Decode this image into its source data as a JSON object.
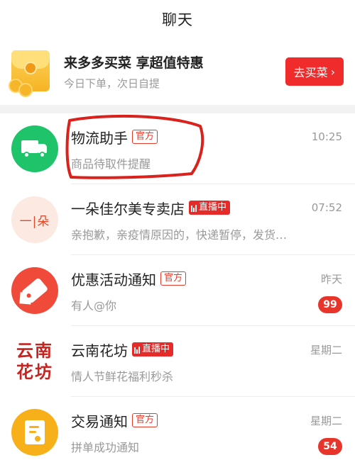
{
  "header": {
    "title": "聊天"
  },
  "banner": {
    "title": "来多多买菜 享超值特惠",
    "subtitle": "今日下单，次日自提",
    "button_label": "去买菜",
    "button_arrow": "›"
  },
  "chats": [
    {
      "name": "物流助手",
      "badge": "官方",
      "badge_type": "official",
      "time": "10:25",
      "preview": "商品待取件提醒",
      "count": "",
      "avatar_icon": "truck-icon"
    },
    {
      "name": "一朵佳尔美专卖店",
      "badge": "直播中",
      "badge_type": "live",
      "time": "07:52",
      "preview": "亲抱歉，亲疫情原因的，快递暂停，发货…",
      "count": "",
      "avatar_text": "一|朵"
    },
    {
      "name": "优惠活动通知",
      "badge": "官方",
      "badge_type": "official",
      "time": "昨天",
      "preview": "有人@你",
      "count": "99",
      "avatar_icon": "tag-icon"
    },
    {
      "name": "云南花坊",
      "badge": "直播中",
      "badge_type": "live",
      "time": "星期二",
      "preview": "情人节鲜花福利秒杀",
      "count": "",
      "avatar_text_line1": "云南",
      "avatar_text_line2": "花坊"
    },
    {
      "name": "交易通知",
      "badge": "官方",
      "badge_type": "official",
      "time": "星期二",
      "preview": "拼单成功通知",
      "count": "54",
      "avatar_icon": "document-icon"
    }
  ],
  "colors": {
    "accent_red": "#f02b2b",
    "green": "#1ec36a",
    "orange": "#f8b01a",
    "annotation_red": "#d9221c"
  }
}
